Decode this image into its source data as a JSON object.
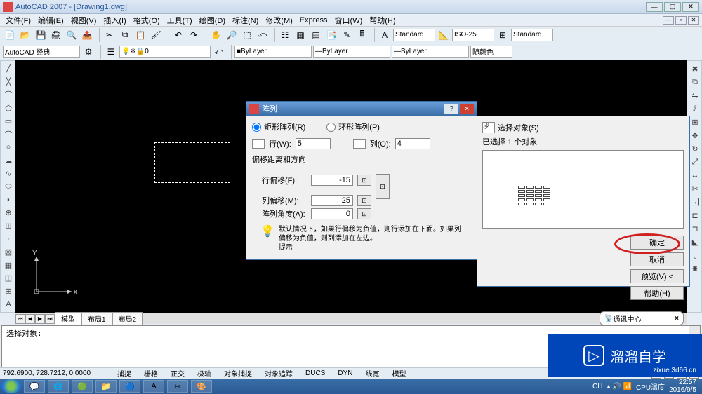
{
  "app": {
    "title": "AutoCAD 2007 - [Drawing1.dwg]"
  },
  "menus": [
    "文件(F)",
    "编辑(E)",
    "视图(V)",
    "插入(I)",
    "格式(O)",
    "工具(T)",
    "绘图(D)",
    "标注(N)",
    "修改(M)",
    "Express",
    "窗口(W)",
    "帮助(H)"
  ],
  "workspace": {
    "name": "AutoCAD 经典",
    "layer": "0"
  },
  "styles": {
    "textstyle": "Standard",
    "dimstyle": "ISO-25",
    "tablestyle": "Standard"
  },
  "props": {
    "color": "ByLayer",
    "ltype": "ByLayer",
    "lweight": "ByLayer",
    "plotstyle": "随颜色"
  },
  "tabs": {
    "model": "模型",
    "layout1": "布局1",
    "layout2": "布局2"
  },
  "cmd": {
    "line1": "选择对象:"
  },
  "status": {
    "coords": "792.6900, 728.7212, 0.0000",
    "toggles": [
      "捕捉",
      "栅格",
      "正交",
      "极轴",
      "对象捕捉",
      "对象追踪",
      "DUCS",
      "DYN",
      "线宽",
      "模型"
    ]
  },
  "dialog": {
    "title": "阵列",
    "rect_array": "矩形阵列(R)",
    "polar_array": "环形阵列(P)",
    "rows_label": "行(W):",
    "cols_label": "列(O):",
    "rows": "5",
    "cols": "4",
    "offset_group": "偏移距离和方向",
    "row_offset_label": "行偏移(F):",
    "col_offset_label": "列偏移(M):",
    "angle_label": "阵列角度(A):",
    "row_offset": "-15",
    "col_offset": "25",
    "angle": "0",
    "hint_label": "提示",
    "hint": "默认情况下，如果行偏移为负值，则行添加在下面。如果列偏移为负值，则列添加在左边。",
    "select_btn": "选择对象(S)",
    "selected": "已选择 1 个对象",
    "ok": "确定",
    "cancel": "取消",
    "preview": "预览(V) <",
    "help": "帮助(H)"
  },
  "comm": {
    "label": "通讯中心"
  },
  "tray": {
    "ime": "CH",
    "cpu_label": "CPU温度",
    "time": "22:57",
    "date": "2016/9/5"
  },
  "watermark": {
    "brand": "溜溜自学",
    "url": "zixue.3d66.cn"
  }
}
